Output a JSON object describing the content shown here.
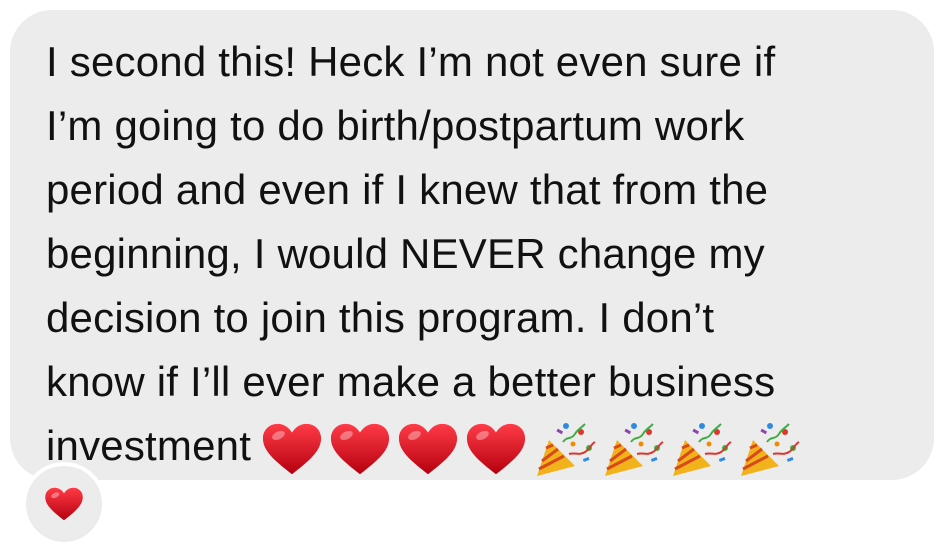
{
  "message": {
    "lines": [
      "I second this! Heck I’m not even sure if",
      "I’m going to do birth/postpartum work",
      "period and even if I knew that from the",
      "beginning, I would NEVER change my",
      "decision to join this program. I don’t",
      "know if I’ll ever make a better business",
      "investment"
    ],
    "trailing_emojis": [
      "heart-icon",
      "heart-icon",
      "heart-icon",
      "heart-icon",
      "party-popper-icon",
      "party-popper-icon",
      "party-popper-icon",
      "party-popper-icon"
    ]
  },
  "reaction": {
    "icon": "heart-icon"
  },
  "colors": {
    "bubble_bg": "#ececed",
    "text": "#111111",
    "heart": "#d0021b"
  }
}
